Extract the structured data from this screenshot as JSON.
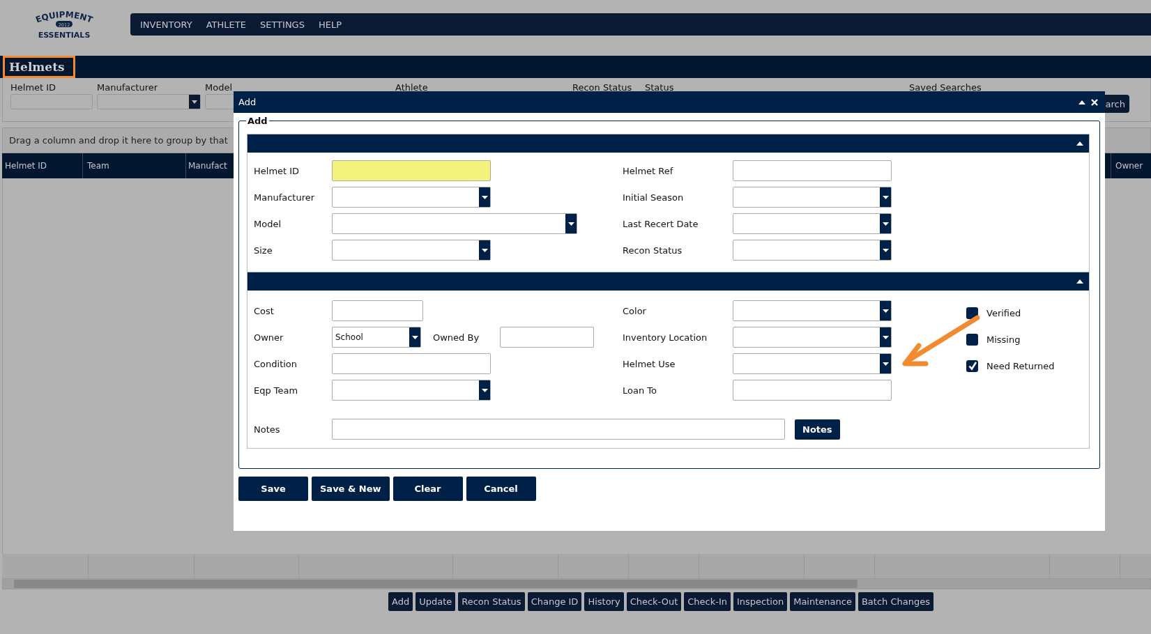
{
  "logo": {
    "top": "EQUIPMENT",
    "year": "2012",
    "bottom": "ESSENTIALS"
  },
  "nav": [
    {
      "label": "INVENTORY"
    },
    {
      "label": "ATHLETE"
    },
    {
      "label": "SETTINGS"
    },
    {
      "label": "HELP"
    }
  ],
  "page_title": "Helmets",
  "filters": [
    {
      "label": "Helmet ID",
      "kind": "text"
    },
    {
      "label": "Manufacturer",
      "kind": "select"
    },
    {
      "label": "Model",
      "kind": "text"
    },
    {
      "label": "Athlete",
      "kind": "hidden"
    },
    {
      "label": "Recon Status",
      "kind": "hidden"
    },
    {
      "label": "Status",
      "kind": "hidden"
    },
    {
      "label": "Saved Searches",
      "kind": "hidden"
    }
  ],
  "search_button": "arch",
  "group_hint": "Drag a column and drop it here to group by that",
  "grid_columns": [
    {
      "label": "Helmet ID"
    },
    {
      "label": "Team"
    },
    {
      "label": "Manufact"
    },
    {
      "label": "Owner"
    }
  ],
  "toolbar": [
    {
      "label": "Add"
    },
    {
      "label": "Update"
    },
    {
      "label": "Recon Status"
    },
    {
      "label": "Change ID"
    },
    {
      "label": "History"
    },
    {
      "label": "Check-Out"
    },
    {
      "label": "Check-In"
    },
    {
      "label": "Inspection"
    },
    {
      "label": "Maintenance"
    },
    {
      "label": "Batch Changes"
    }
  ],
  "dialog": {
    "title": "Add",
    "legend": "Add",
    "section1": {
      "expanded": true,
      "left": [
        {
          "label": "Helmet ID",
          "kind": "text",
          "highlighted": true
        },
        {
          "label": "Manufacturer",
          "kind": "select",
          "highlighted": false
        },
        {
          "label": "Model",
          "kind": "select",
          "highlighted": false
        },
        {
          "label": "Size",
          "kind": "select",
          "highlighted": false
        }
      ],
      "right": [
        {
          "label": "Helmet Ref",
          "kind": "text"
        },
        {
          "label": "Initial Season",
          "kind": "select"
        },
        {
          "label": "Last Recert Date",
          "kind": "select"
        },
        {
          "label": "Recon Status",
          "kind": "select"
        }
      ]
    },
    "section2": {
      "expanded": true,
      "left": [
        {
          "label": "Cost",
          "kind": "text"
        },
        {
          "label": "Owner",
          "kind": "select",
          "value": "School",
          "extra_label": "Owned By"
        },
        {
          "label": "Condition",
          "kind": "text"
        },
        {
          "label": "Eqp Team",
          "kind": "select"
        }
      ],
      "right": [
        {
          "label": "Color",
          "kind": "select"
        },
        {
          "label": "Inventory Location",
          "kind": "select"
        },
        {
          "label": "Helmet Use",
          "kind": "select"
        },
        {
          "label": "Loan To",
          "kind": "text"
        }
      ],
      "checkboxes": [
        {
          "label": "Verified",
          "checked": false
        },
        {
          "label": "Missing",
          "checked": false
        },
        {
          "label": "Need Returned",
          "checked": true
        }
      ],
      "notes_label": "Notes",
      "notes_button": "Notes"
    },
    "buttons": [
      {
        "label": "Save"
      },
      {
        "label": "Save & New"
      },
      {
        "label": "Clear"
      },
      {
        "label": "Cancel"
      }
    ]
  }
}
